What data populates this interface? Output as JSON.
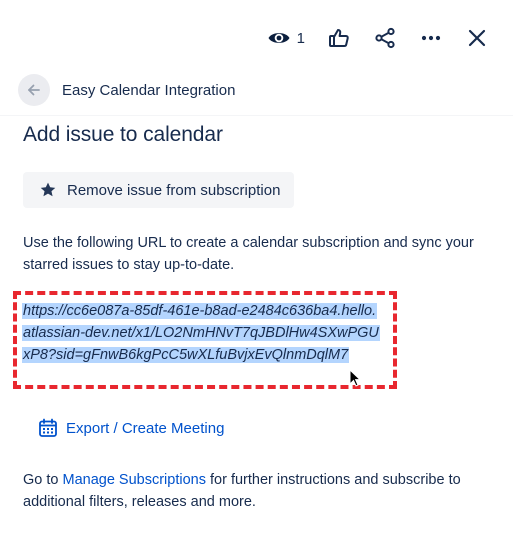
{
  "header": {
    "watch_count": "1",
    "icons": [
      "eye-icon",
      "thumbs-up-icon",
      "share-icon",
      "more-icon",
      "close-icon"
    ]
  },
  "breadcrumb": {
    "app_title": "Easy Calendar Integration"
  },
  "main": {
    "page_title": "Add issue to calendar",
    "remove_button_label": "Remove issue from subscription",
    "description": "Use the following URL to create a calendar subscription and sync your starred issues to stay up-to-date.",
    "subscription_url": "https://cc6e087a-85df-461e-b8ad-e2484c636ba4.hello.atlassian-dev.net/x1/LO2NmHNvT7qJBDlHw4SXwPGUxP8?sid=gFnwB6kgPcC5wXLfuBvjxEvQlnmDqlM7",
    "export_label": "Export / Create Meeting",
    "footer_prefix": "Go to ",
    "footer_link": "Manage Subscriptions",
    "footer_suffix": " for further instructions and subscribe to additional filters, releases and more."
  },
  "colors": {
    "text": "#172B4D",
    "link": "#0052CC",
    "selection": "#B4D5FE",
    "annotation": "#E8272F",
    "button_bg": "#F4F5F7"
  }
}
